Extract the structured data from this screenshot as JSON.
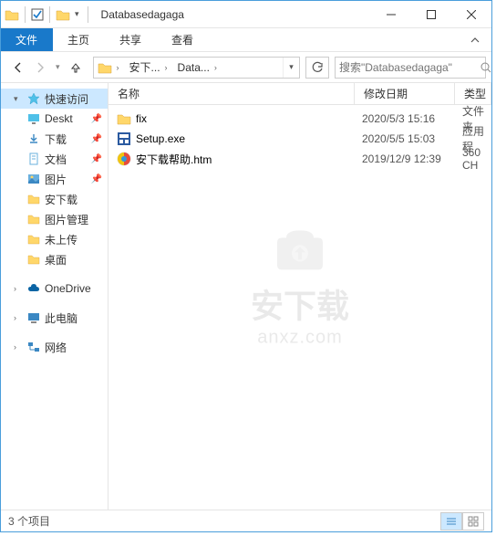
{
  "titlebar": {
    "title": "Databasedagaga"
  },
  "tabs": {
    "file": "文件",
    "home": "主页",
    "share": "共享",
    "view": "查看"
  },
  "breadcrumb": {
    "seg1": "安下...",
    "seg2": "Data..."
  },
  "search": {
    "placeholder": "搜索\"Databasedagaga\""
  },
  "columns": {
    "name": "名称",
    "date": "修改日期",
    "type": "类型"
  },
  "sidebar": {
    "quick": "快速访问",
    "items": [
      {
        "label": "Deskt",
        "icon": "desktop"
      },
      {
        "label": "下载",
        "icon": "download"
      },
      {
        "label": "文档",
        "icon": "document"
      },
      {
        "label": "图片",
        "icon": "picture"
      },
      {
        "label": "安下载",
        "icon": "folder"
      },
      {
        "label": "图片管理",
        "icon": "folder"
      },
      {
        "label": "未上传",
        "icon": "folder"
      },
      {
        "label": "桌面",
        "icon": "folder"
      }
    ],
    "onedrive": "OneDrive",
    "thispc": "此电脑",
    "network": "网络"
  },
  "files": [
    {
      "name": "fix",
      "date": "2020/5/3 15:16",
      "type": "文件夹",
      "icon": "folder"
    },
    {
      "name": "Setup.exe",
      "date": "2020/5/5 15:03",
      "type": "应用程",
      "icon": "exe"
    },
    {
      "name": "安下载帮助.htm",
      "date": "2019/12/9 12:39",
      "type": "360 CH",
      "icon": "htm"
    }
  ],
  "statusbar": {
    "count": "3 个项目"
  },
  "watermark": {
    "line1": "安下载",
    "line2": "anxz.com"
  }
}
